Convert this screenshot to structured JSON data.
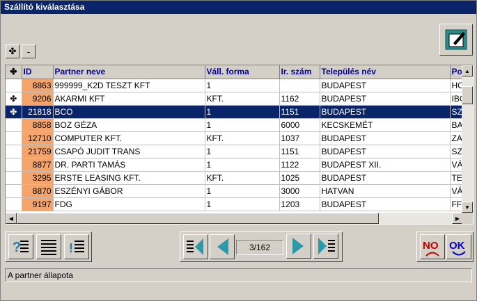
{
  "window": {
    "title": "Szállító kiválasztása"
  },
  "toolbar": {
    "expand_symbol": "✤",
    "collapse_symbol": "-"
  },
  "grid": {
    "columns": [
      "✤",
      "ID",
      "Partner neve",
      "Váll. forma",
      "Ir. szám",
      "Település név",
      "Po"
    ],
    "rows": [
      {
        "mark": "",
        "id": "8863",
        "name": "999999_K2D TESZT KFT",
        "form": "1",
        "zip": "",
        "city": "BUDAPEST",
        "extra": "HO"
      },
      {
        "mark": "✤",
        "id": "9206",
        "name": "AKARMI KFT",
        "form": "KFT.",
        "zip": "1162",
        "city": "BUDAPEST",
        "extra": "IBO"
      },
      {
        "mark": "✤",
        "id": "21818",
        "name": "BCO",
        "form": "1",
        "zip": "1151",
        "city": "BUDAPEST",
        "extra": "SZ",
        "selected": true
      },
      {
        "mark": "",
        "id": "8858",
        "name": "BOZ GÉZA",
        "form": "1",
        "zip": "6000",
        "city": "KECSKEMÉT",
        "extra": "BA"
      },
      {
        "mark": "",
        "id": "12710",
        "name": "COMPUTER KFT.",
        "form": "KFT.",
        "zip": "1037",
        "city": "BUDAPEST",
        "extra": "ZA"
      },
      {
        "mark": "",
        "id": "21759",
        "name": "CSAPÓ JUDIT TRANS",
        "form": "1",
        "zip": "1151",
        "city": "BUDAPEST",
        "extra": "SZ"
      },
      {
        "mark": "",
        "id": "8877",
        "name": "DR. PARTI TAMÁS",
        "form": "1",
        "zip": "1122",
        "city": "BUDAPEST XII.",
        "extra": "VÁ"
      },
      {
        "mark": "",
        "id": "3295",
        "name": "ERSTE LEASING KFT.",
        "form": "KFT.",
        "zip": "1025",
        "city": "BUDAPEST",
        "extra": "TE"
      },
      {
        "mark": "",
        "id": "8870",
        "name": "ESZÉNYI GÁBOR",
        "form": "1",
        "zip": "3000",
        "city": "HATVAN",
        "extra": "VÁ"
      },
      {
        "mark": "",
        "id": "9197",
        "name": "FDG",
        "form": "1",
        "zip": "1203",
        "city": "BUDAPEST",
        "extra": "FF"
      }
    ]
  },
  "navigator": {
    "position": "3/162"
  },
  "dialog_buttons": {
    "no_label": "NO",
    "ok_label": "OK"
  },
  "status": {
    "text": "A partner állapota"
  },
  "colors": {
    "title_bg": "#0a246a",
    "id_cell": "#f5a46b",
    "header_text": "#0000a0",
    "selection": "#0a246a"
  },
  "icons": [
    "edit-window-icon",
    "help-icon",
    "list-icon",
    "sort-list-icon",
    "first-record-icon",
    "prev-record-icon",
    "next-record-icon",
    "last-record-icon",
    "no-icon",
    "ok-icon"
  ]
}
